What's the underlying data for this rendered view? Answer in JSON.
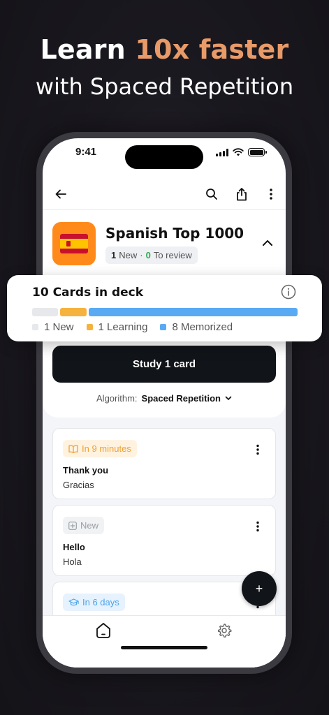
{
  "headline": {
    "line1_prefix": "Learn ",
    "line1_accent": "10x faster",
    "line2": "with Spaced Repetition"
  },
  "status": {
    "time": "9:41"
  },
  "deck": {
    "title": "Spanish Top 1000",
    "badge_new_count": "1",
    "badge_new_label": "New",
    "badge_sep": "·",
    "badge_review_count": "0",
    "badge_review_label": "To review"
  },
  "summary": {
    "title": "10 Cards in deck",
    "new_label": "1 New",
    "learning_label": "1 Learning",
    "memorized_label": "8 Memorized",
    "new_count": 1,
    "learning_count": 1,
    "memorized_count": 8,
    "colors": {
      "new": "#e6e8eb",
      "learning": "#f6b23e",
      "memorized": "#59aaf3"
    }
  },
  "study_button": "Study 1 card",
  "algorithm": {
    "label": "Algorithm:",
    "value": "Spaced Repetition"
  },
  "cards": [
    {
      "tag": "In 9 minutes",
      "tag_style": "orange",
      "front": "Thank you",
      "back": "Gracias"
    },
    {
      "tag": "New",
      "tag_style": "gray",
      "front": "Hello",
      "back": "Hola"
    },
    {
      "tag": "In 6 days",
      "tag_style": "blue"
    }
  ],
  "fab_label": "+"
}
